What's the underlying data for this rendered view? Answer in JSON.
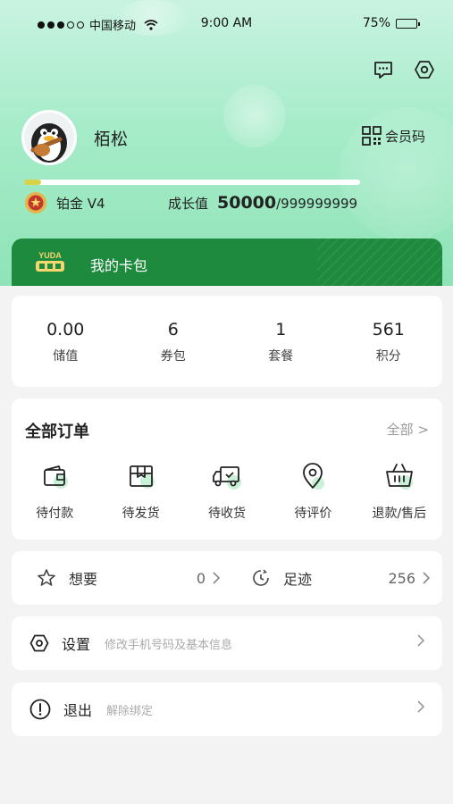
{
  "status_bar": {
    "carrier": "中国移动",
    "time": "9:00 AM",
    "battery": "75%"
  },
  "profile": {
    "name": "栢松",
    "member_code_label": "会员码",
    "level": "铂金 V4",
    "growth_label": "成长值",
    "growth_value": "50000",
    "growth_max": "/999999999",
    "growth_progress": 0.05
  },
  "card_bag": {
    "logo_text": "YUDA",
    "title": "我的卡包"
  },
  "stats": [
    {
      "value": "0.00",
      "label": "储值"
    },
    {
      "value": "6",
      "label": "券包"
    },
    {
      "value": "1",
      "label": "套餐"
    },
    {
      "value": "561",
      "label": "积分"
    }
  ],
  "orders": {
    "title": "全部订单",
    "all_link": "全部 >",
    "items": [
      {
        "label": "待付款",
        "icon": "wallet-icon"
      },
      {
        "label": "待发货",
        "icon": "package-icon"
      },
      {
        "label": "待收货",
        "icon": "truck-icon"
      },
      {
        "label": "待评价",
        "icon": "location-pin-icon"
      },
      {
        "label": "退款/售后",
        "icon": "basket-icon"
      }
    ]
  },
  "wish": {
    "label": "想要",
    "count": "0"
  },
  "footprint": {
    "label": "足迹",
    "count": "256"
  },
  "settings": {
    "label": "设置",
    "sub": "修改手机号码及基本信息"
  },
  "logout": {
    "label": "退出",
    "sub": "解除绑定"
  },
  "colors": {
    "accent_green": "#1e8a3e",
    "hero_green": "#a6ecc9",
    "progress_yellow": "#d6d34a"
  }
}
